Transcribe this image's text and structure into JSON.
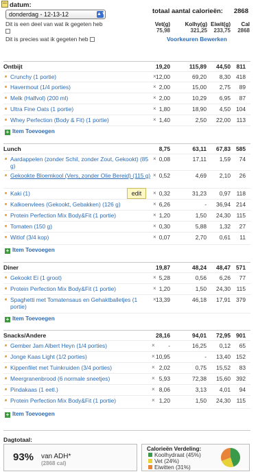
{
  "header": {
    "date_label": "datum:",
    "date_value": "donderdag - 12-13-12",
    "checkbox1": "Dit is een deel van wat ik gegeten heb",
    "checkbox2": "Dit is precies wat ik gegeten heb",
    "total_label": "totaal aantal calorieën:",
    "total_value": "2868",
    "macro_headers": [
      "Vet(g)",
      "Kolhy(g)",
      "Eiwit(g)",
      "Cal"
    ],
    "macro_values": [
      "75,98",
      "321,25",
      "233,75",
      "2868"
    ],
    "preferences_link": "Voorkeuren Bewerken"
  },
  "meals": [
    {
      "title": "Ontbijt",
      "totals": [
        "19,20",
        "115,89",
        "44,50",
        "811"
      ],
      "add_label": "Item Toevoegen",
      "items": [
        {
          "name": "Crunchy (1 portie)",
          "vals": [
            "12,00",
            "69,20",
            "8,30",
            "418"
          ]
        },
        {
          "name": "Havermout (1/4 porties)",
          "vals": [
            "2,00",
            "15,00",
            "2,75",
            "89"
          ]
        },
        {
          "name": "Melk (Halfvol) (200 ml)",
          "vals": [
            "2,00",
            "10,29",
            "6,95",
            "87"
          ]
        },
        {
          "name": "Ultra Fine Oats (1 portie)",
          "vals": [
            "1,80",
            "18,90",
            "4,50",
            "104"
          ]
        },
        {
          "name": "Whey Perfection (Body & Fit) (1 portie)",
          "vals": [
            "1,40",
            "2,50",
            "22,00",
            "113"
          ]
        }
      ]
    },
    {
      "title": "Lunch",
      "totals": [
        "8,75",
        "63,11",
        "67,83",
        "585"
      ],
      "add_label": "Item Toevoegen",
      "items": [
        {
          "name": "Aardappelen (zonder Schil, zonder Zout, Gekookt) (85 g)",
          "vals": [
            "0,08",
            "17,11",
            "1,59",
            "74"
          ]
        },
        {
          "name": "Gekookte Bloemkool (Vers, zonder Olie Bereid) (115 g)",
          "vals": [
            "0,52",
            "4,69",
            "2,10",
            "26"
          ]
        },
        {
          "name": "Kaki (1)",
          "vals": [
            "0,32",
            "31,23",
            "0,97",
            "118"
          ]
        },
        {
          "name": "Kalkoenvlees (Gekookt, Gebakken) (126 g)",
          "vals": [
            "6,26",
            "-",
            "36,94",
            "214"
          ]
        },
        {
          "name": "Protein Perfection Mix Body&Fit (1 portie)",
          "vals": [
            "1,20",
            "1,50",
            "24,30",
            "115"
          ]
        },
        {
          "name": "Tomaten (150 g)",
          "vals": [
            "0,30",
            "5,88",
            "1,32",
            "27"
          ]
        },
        {
          "name": "Witlof (3/4 kop)",
          "vals": [
            "0,07",
            "2,70",
            "0,61",
            "11"
          ]
        }
      ]
    },
    {
      "title": "Diner",
      "totals": [
        "19,87",
        "48,24",
        "48,47",
        "571"
      ],
      "add_label": "Item Toevoegen",
      "items": [
        {
          "name": "Gekookt Ei (1 groot)",
          "vals": [
            "5,28",
            "0,56",
            "6,26",
            "77"
          ]
        },
        {
          "name": "Protein Perfection Mix Body&Fit (1 portie)",
          "vals": [
            "1,20",
            "1,50",
            "24,30",
            "115"
          ]
        },
        {
          "name": "Spaghetti met Tomatensaus en Gehaktballetjes (1 portie)",
          "vals": [
            "13,39",
            "46,18",
            "17,91",
            "379"
          ]
        }
      ]
    },
    {
      "title": "Snacks/Andere",
      "totals": [
        "28,16",
        "94,01",
        "72,95",
        "901"
      ],
      "add_label": "Item Toevoegen",
      "items": [
        {
          "name": "Gember Jam Albert Heyn (1/4 porties)",
          "vals": [
            "-",
            "16,25",
            "0,12",
            "65"
          ]
        },
        {
          "name": "Jonge Kaas Light (1/2 porties)",
          "vals": [
            "10,95",
            "-",
            "13,40",
            "152"
          ]
        },
        {
          "name": "Kippenfilet met Tuinkruiden (3/4 porties)",
          "vals": [
            "2,02",
            "0,75",
            "15,52",
            "83"
          ]
        },
        {
          "name": "Meergranenbrood (6 normale sneetjes)",
          "vals": [
            "5,93",
            "72,38",
            "15,60",
            "392"
          ]
        },
        {
          "name": "Pindakaas (1 eetl.)",
          "vals": [
            "8,06",
            "3,13",
            "4,01",
            "94"
          ]
        },
        {
          "name": "Protein Perfection Mix Body&Fit (1 portie)",
          "vals": [
            "1,20",
            "1,50",
            "24,30",
            "115"
          ]
        }
      ]
    }
  ],
  "tooltip": "edit",
  "footer": {
    "day_total_label": "Dagtotaal:",
    "percent": "93%",
    "adh_label": "van ADH*",
    "adh_sub": "(2868 cal)",
    "distribution_title": "Calorieën Verdeling:",
    "legend": [
      {
        "label": "Koolhydraat (45%)",
        "color": "#3a9a4a",
        "value": 45
      },
      {
        "label": "Vet (24%)",
        "color": "#e8d23a",
        "value": 24
      },
      {
        "label": "Eiwitten (31%)",
        "color": "#e8833a",
        "value": 31
      }
    ]
  },
  "icons": {
    "delete": "×",
    "bullet": "square-bullet",
    "add": "plus-icon",
    "calendar": "calendar-icon"
  }
}
